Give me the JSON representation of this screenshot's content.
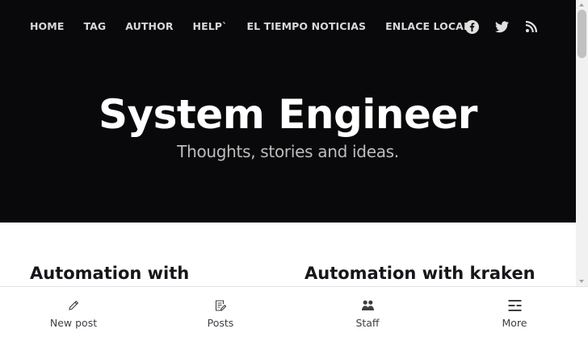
{
  "nav": {
    "items": [
      {
        "label": "HOME"
      },
      {
        "label": "TAG"
      },
      {
        "label": "AUTHOR"
      },
      {
        "label": "HELP`"
      },
      {
        "label": "EL TIEMPO NOTICIAS"
      },
      {
        "label": "ENLACE LOCAL"
      }
    ],
    "social": [
      {
        "icon": "facebook-icon"
      },
      {
        "icon": "twitter-icon"
      },
      {
        "icon": "rss-icon"
      }
    ]
  },
  "hero": {
    "title": "System Engineer",
    "description": "Thoughts, stories and ideas.",
    "background_color": "#09090b"
  },
  "posts": [
    {
      "title": "Automation with"
    },
    {
      "title": "Automation with kraken"
    }
  ],
  "bottom_bar": {
    "tabs": [
      {
        "label": "New post",
        "icon": "pencil-icon"
      },
      {
        "label": "Posts",
        "icon": "document-edit-icon"
      },
      {
        "label": "Staff",
        "icon": "users-icon"
      },
      {
        "label": "More",
        "icon": "menu-icon"
      }
    ]
  }
}
